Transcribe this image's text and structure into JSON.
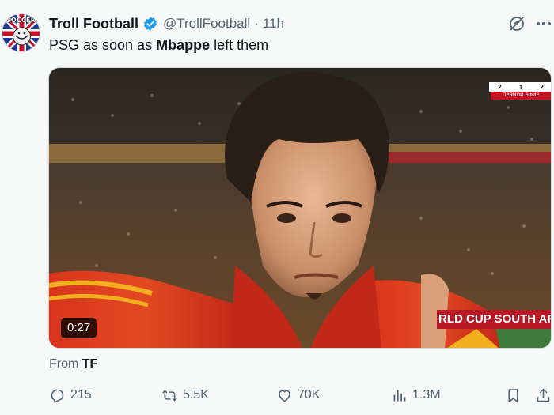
{
  "author": {
    "display_name": "Troll Football",
    "handle": "@TrollFootball",
    "separator": "·",
    "time": "11h",
    "avatar_text": "SOCCER"
  },
  "tweet": {
    "text_before": "PSG as soon as ",
    "text_bold": "Mbappe",
    "text_after": " left them"
  },
  "media": {
    "duration": "0:27",
    "score_bug": [
      "2",
      "1",
      "2"
    ],
    "broadcast_badge": "ПРЯМОЙ ЭФИР",
    "banner": "RLD CUP SOUTH AF"
  },
  "source": {
    "prefix": "From ",
    "name": "TF"
  },
  "actions": {
    "replies": "215",
    "reposts": "5.5K",
    "likes": "70K",
    "views": "1.3M"
  },
  "colors": {
    "verified": "#1d9bf0",
    "secondary_text": "#536471",
    "primary_text": "#0f1419"
  }
}
